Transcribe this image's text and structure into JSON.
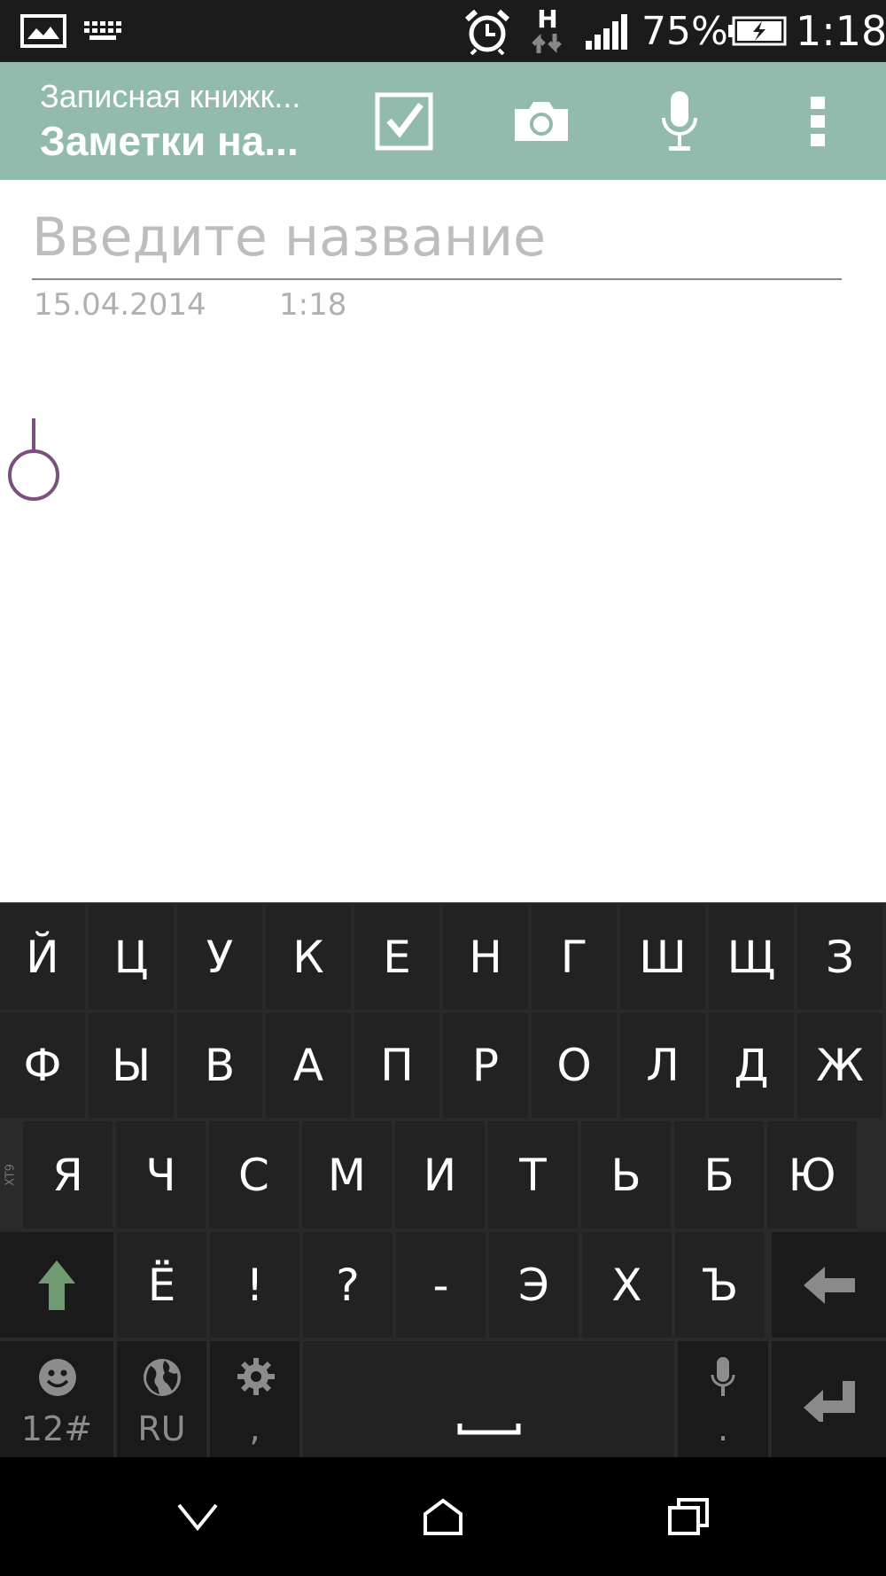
{
  "status_bar": {
    "battery": "75%",
    "time": "1:18",
    "network_type": "H",
    "icons": [
      "image-notification-icon",
      "keyboard-icon",
      "alarm-icon",
      "data-transfer-icon",
      "signal-icon",
      "battery-charging-icon"
    ]
  },
  "action_bar": {
    "subtitle": "Записная книжк...",
    "title": "Заметки на...",
    "background": "#93bbad",
    "actions": [
      "checkbox-icon",
      "camera-icon",
      "microphone-icon",
      "overflow-menu-icon"
    ]
  },
  "note": {
    "title_placeholder": "Введите название",
    "date": "15.04.2014",
    "time": "1:18",
    "cursor_color": "#7b4f7e"
  },
  "keyboard": {
    "row1": [
      "Й",
      "Ц",
      "У",
      "К",
      "Е",
      "Н",
      "Г",
      "Ш",
      "Щ",
      "З"
    ],
    "row2": [
      "Ф",
      "Ы",
      "В",
      "А",
      "П",
      "Р",
      "О",
      "Л",
      "Д",
      "Ж"
    ],
    "row3": [
      "Я",
      "Ч",
      "С",
      "М",
      "И",
      "Т",
      "Ь",
      "Б",
      "Ю"
    ],
    "row4": [
      "Ё",
      "!",
      "?",
      "-",
      "Э",
      "Х",
      "Ъ"
    ],
    "xt9_label": "XT9",
    "numbers_label": "12#",
    "language_label": "RU",
    "settings_sub": ",",
    "mic_sub": ".",
    "shift_color": "#6f9a72"
  },
  "nav_bar": {
    "buttons": [
      "back-icon",
      "home-icon",
      "recents-icon"
    ]
  }
}
